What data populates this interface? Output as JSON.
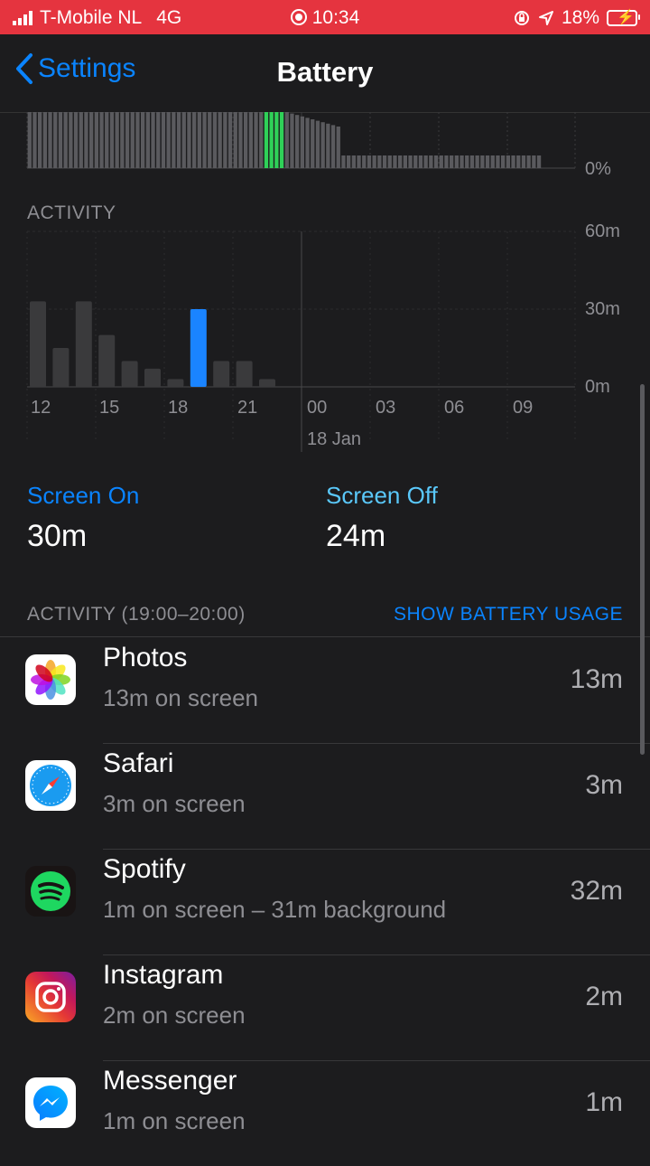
{
  "status_bar": {
    "carrier": "T-Mobile NL",
    "network": "4G",
    "time": "10:34",
    "battery_percent": "18%",
    "background_color": "#e5343f"
  },
  "nav": {
    "back_label": "Settings",
    "title": "Battery"
  },
  "battery_chart": {
    "y_label": "0%"
  },
  "activity_chart": {
    "label": "ACTIVITY",
    "y_ticks": [
      "60m",
      "30m",
      "0m"
    ],
    "x_ticks": [
      "12",
      "15",
      "18",
      "21",
      "00",
      "03",
      "06",
      "09"
    ],
    "date_label": "18 Jan",
    "bar_color_selected_on": "#1a84ff",
    "bar_color_selected_off": "#5ac8fa",
    "bar_color_on": "#3a3a3c",
    "bar_color_off": "#545456"
  },
  "chart_data": {
    "type": "bar",
    "categories": [
      "12",
      "13",
      "14",
      "15",
      "16",
      "17",
      "18",
      "19",
      "20",
      "21",
      "22",
      "23",
      "00",
      "01",
      "02",
      "03",
      "04",
      "05",
      "06",
      "07",
      "08",
      "09",
      "10"
    ],
    "series": [
      {
        "name": "Screen On",
        "values": [
          33,
          15,
          33,
          20,
          10,
          7,
          3,
          30,
          10,
          10,
          3,
          0,
          0,
          0,
          0,
          0,
          0,
          0,
          0,
          0,
          0,
          0,
          0
        ]
      },
      {
        "name": "Screen Off",
        "values": [
          0,
          0,
          0,
          0,
          0,
          0,
          0,
          0,
          0,
          0,
          0,
          0,
          0,
          0,
          0,
          0,
          0,
          0,
          0,
          0,
          0,
          0,
          0
        ]
      }
    ],
    "ylim": [
      0,
      60
    ],
    "y_ticks": [
      "60m",
      "30m",
      "0m"
    ]
  },
  "summary": {
    "screen_on_label": "Screen On",
    "screen_on_value": "30m",
    "screen_off_label": "Screen Off",
    "screen_off_value": "24m"
  },
  "activity_list": {
    "header": "ACTIVITY (19:00–20:00)",
    "action": "SHOW BATTERY USAGE",
    "apps": [
      {
        "name": "Photos",
        "detail": "13m on screen",
        "time": "13m",
        "icon": "photos-icon"
      },
      {
        "name": "Safari",
        "detail": "3m on screen",
        "time": "3m",
        "icon": "safari-icon"
      },
      {
        "name": "Spotify",
        "detail": "1m on screen – 31m background",
        "time": "32m",
        "icon": "spotify-icon"
      },
      {
        "name": "Instagram",
        "detail": "2m on screen",
        "time": "2m",
        "icon": "instagram-icon"
      },
      {
        "name": "Messenger",
        "detail": "1m on screen",
        "time": "1m",
        "icon": "messenger-icon"
      }
    ]
  }
}
